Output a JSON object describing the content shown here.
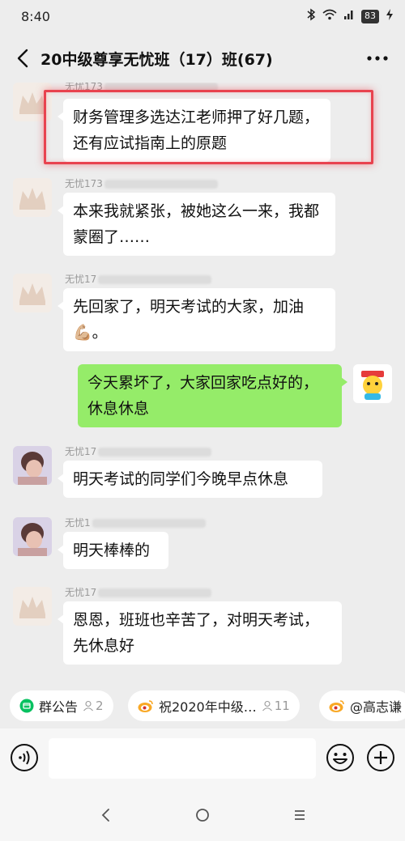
{
  "status_bar": {
    "time": "8:40",
    "battery": "83"
  },
  "header": {
    "title": "20中级尊享无忧班（17）班(67)"
  },
  "messages": [
    {
      "sender": "无忧173",
      "text": "财务管理多选达江老师押了好几题，还有应试指南上的原题",
      "side": "left"
    },
    {
      "sender": "无忧173",
      "text": "本来我就紧张，被她这么一来，我都蒙圈了……",
      "side": "left"
    },
    {
      "sender": "无忧17",
      "text": "先回家了，明天考试的大家，加油💪🏼。",
      "side": "left"
    },
    {
      "sender": "",
      "text": "今天累坏了，大家回家吃点好的，休息休息",
      "side": "right"
    },
    {
      "sender": "无忧17",
      "text": "明天考试的同学们今晚早点休息",
      "side": "left"
    },
    {
      "sender": "无忧1",
      "text": "明天棒棒的",
      "side": "left"
    },
    {
      "sender": "无忧17",
      "text": "恩恩，班班也辛苦了，对明天考试，先休息好",
      "side": "left"
    }
  ],
  "quick_bar": [
    {
      "label": "群公告",
      "count": "2",
      "icon": "notice-icon"
    },
    {
      "label": "祝2020年中级…",
      "count": "11",
      "icon": "weibo-icon"
    },
    {
      "label": "@高志谦",
      "count": "",
      "icon": "weibo-icon"
    }
  ],
  "input": {
    "placeholder": ""
  },
  "colors": {
    "background": "#ededed",
    "bubble_self": "#95ec69",
    "bubble_other": "#ffffff",
    "highlight": "#e8434f"
  }
}
